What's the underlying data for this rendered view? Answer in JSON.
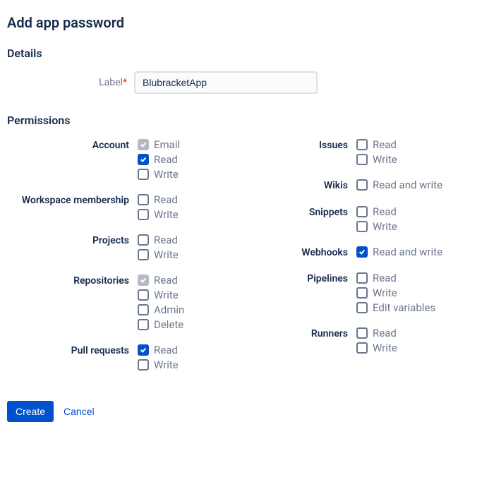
{
  "title": "Add app password",
  "details": {
    "heading": "Details",
    "label_field_label": "Label",
    "label_value": "BlubracketApp"
  },
  "permissions": {
    "heading": "Permissions",
    "left": [
      {
        "label": "Account",
        "options": [
          {
            "label": "Email",
            "state": "disabled"
          },
          {
            "label": "Read",
            "state": "checked"
          },
          {
            "label": "Write",
            "state": "unchecked"
          }
        ]
      },
      {
        "label": "Workspace membership",
        "options": [
          {
            "label": "Read",
            "state": "unchecked"
          },
          {
            "label": "Write",
            "state": "unchecked"
          }
        ]
      },
      {
        "label": "Projects",
        "options": [
          {
            "label": "Read",
            "state": "unchecked"
          },
          {
            "label": "Write",
            "state": "unchecked"
          }
        ]
      },
      {
        "label": "Repositories",
        "options": [
          {
            "label": "Read",
            "state": "disabled"
          },
          {
            "label": "Write",
            "state": "unchecked"
          },
          {
            "label": "Admin",
            "state": "unchecked"
          },
          {
            "label": "Delete",
            "state": "unchecked"
          }
        ]
      },
      {
        "label": "Pull requests",
        "options": [
          {
            "label": "Read",
            "state": "checked"
          },
          {
            "label": "Write",
            "state": "unchecked"
          }
        ]
      }
    ],
    "right": [
      {
        "label": "Issues",
        "options": [
          {
            "label": "Read",
            "state": "unchecked"
          },
          {
            "label": "Write",
            "state": "unchecked"
          }
        ]
      },
      {
        "label": "Wikis",
        "options": [
          {
            "label": "Read and write",
            "state": "unchecked"
          }
        ]
      },
      {
        "label": "Snippets",
        "options": [
          {
            "label": "Read",
            "state": "unchecked"
          },
          {
            "label": "Write",
            "state": "unchecked"
          }
        ]
      },
      {
        "label": "Webhooks",
        "options": [
          {
            "label": "Read and write",
            "state": "checked"
          }
        ]
      },
      {
        "label": "Pipelines",
        "options": [
          {
            "label": "Read",
            "state": "unchecked"
          },
          {
            "label": "Write",
            "state": "unchecked"
          },
          {
            "label": "Edit variables",
            "state": "unchecked"
          }
        ]
      },
      {
        "label": "Runners",
        "options": [
          {
            "label": "Read",
            "state": "unchecked"
          },
          {
            "label": "Write",
            "state": "unchecked"
          }
        ]
      }
    ]
  },
  "actions": {
    "create": "Create",
    "cancel": "Cancel"
  }
}
